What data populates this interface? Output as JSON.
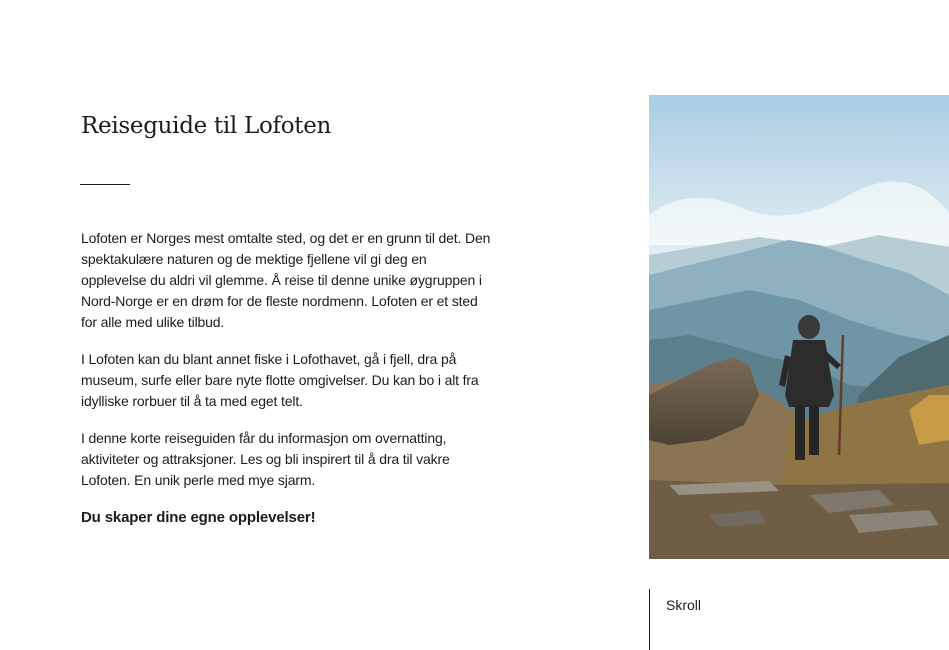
{
  "title": "Reiseguide til Lofoten",
  "paragraphs": [
    "Lofoten er Norges mest omtalte sted, og det er en grunn til det. Den spektakulære naturen og de mektige fjellene vil gi deg en opplevelse du aldri vil glemme. Å reise til denne unike øygruppen i Nord-Norge er en drøm for de fleste nordmenn. Lofoten er et sted for alle med ulike tilbud.",
    "I Lofoten kan du blant annet fiske i Lofothavet, gå i fjell, dra på museum, surfe eller bare nyte flotte omgivelser. Du kan bo i alt fra idylliske rorbuer til å ta med eget telt.",
    "I denne korte reiseguiden får du informasjon om overnatting, aktiviteter og attraksjoner. Les og bli inspirert til å dra til vakre Lofoten. En unik perle med mye sjarm."
  ],
  "tagline": "Du skaper dine egne opplevelser!",
  "scroll_label": "Skroll"
}
